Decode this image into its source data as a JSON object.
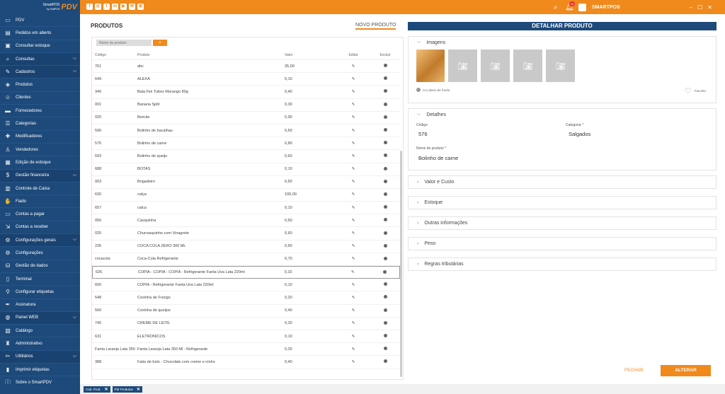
{
  "app": {
    "logo_small": "SmartPOS",
    "logo_small2": "by SoftPOS",
    "logo_big": "PDV",
    "brand": "SMARTPOS",
    "notif_count": "11"
  },
  "icons": {
    "search": "search-icon",
    "bell": "bell-icon",
    "minimize": "minimize-icon",
    "maximize": "maximize-icon",
    "close": "close-icon"
  },
  "colors": {
    "accent": "#f08a1c",
    "sidebar": "#1d4a7a"
  },
  "sidebar": {
    "items": [
      {
        "label": "PDV",
        "icon": "monitor-icon",
        "group": false
      },
      {
        "label": "Pedidos em aberto",
        "icon": "clipboard-icon",
        "group": false
      },
      {
        "label": "Consultar estoque",
        "icon": "box-icon",
        "group": false
      },
      {
        "label": "Consultas",
        "icon": "search-icon",
        "group": true
      },
      {
        "label": "Cadastros",
        "icon": "pencil-icon",
        "group": true
      },
      {
        "label": "Produtos",
        "icon": "tag-icon",
        "group": false
      },
      {
        "label": "Clientes",
        "icon": "user-icon",
        "group": false
      },
      {
        "label": "Fornecedores",
        "icon": "truck-icon",
        "group": false
      },
      {
        "label": "Categorias",
        "icon": "list-icon",
        "group": false
      },
      {
        "label": "Modificadores",
        "icon": "puzzle-icon",
        "group": false
      },
      {
        "label": "Vendedores",
        "icon": "person-icon",
        "group": false
      },
      {
        "label": "Edição de estoque",
        "icon": "edit-box-icon",
        "group": false
      },
      {
        "label": "Gestão financeira",
        "icon": "money-icon",
        "group": true
      },
      {
        "label": "Controle de Caixa",
        "icon": "register-icon",
        "group": false
      },
      {
        "label": "Fiado",
        "icon": "hand-icon",
        "group": false
      },
      {
        "label": "Contas a pagar",
        "icon": "card-icon",
        "group": false
      },
      {
        "label": "Contas a receber",
        "icon": "receive-icon",
        "group": false
      },
      {
        "label": "Configurações gerais",
        "icon": "gear-icon",
        "group": true
      },
      {
        "label": "Configurações",
        "icon": "gear-icon",
        "group": false
      },
      {
        "label": "Gestão de dados",
        "icon": "database-icon",
        "group": false
      },
      {
        "label": "Terminal",
        "icon": "terminal-icon",
        "group": false
      },
      {
        "label": "Configurar etiquetas",
        "icon": "label-icon",
        "group": false
      },
      {
        "label": "Assinatura",
        "icon": "pen-icon",
        "group": false
      },
      {
        "label": "Painel WEB",
        "icon": "globe-icon",
        "group": true
      },
      {
        "label": "Catálogo",
        "icon": "book-icon",
        "group": false
      },
      {
        "label": "Administrativo",
        "icon": "admin-icon",
        "group": false
      },
      {
        "label": "Utilitários",
        "icon": "tools-icon",
        "group": true
      },
      {
        "label": "Imprimir etiquetas",
        "icon": "barcode-icon",
        "group": false
      },
      {
        "label": "Sobre o SmartPDV",
        "icon": "info-icon",
        "group": false
      }
    ]
  },
  "products": {
    "title": "PRODUTOS",
    "new_button": "NOVO PRODUTO",
    "search_placeholder": "Nome do produto",
    "columns": {
      "code": "Código",
      "product": "Produto",
      "value": "Valor",
      "edit": "Editar",
      "delete": "Excluir"
    },
    "rows": [
      {
        "code": "761",
        "name": "abc",
        "value": "35,00"
      },
      {
        "code": "649",
        "name": "ALEXA",
        "value": "0,10"
      },
      {
        "code": "340",
        "name": "Bala Fini Tubes Morango 80g",
        "value": "0,40"
      },
      {
        "code": "001",
        "name": "Banana Split",
        "value": "0,30"
      },
      {
        "code": "020",
        "name": "Beirute",
        "value": "0,90"
      },
      {
        "code": "596",
        "name": "Bolinho de bacalhau",
        "value": "0,50"
      },
      {
        "code": "576",
        "name": "Bolinho de carne",
        "value": "0,80"
      },
      {
        "code": "593",
        "name": "Bolinho de queijo",
        "value": "0,60"
      },
      {
        "code": "688",
        "name": "BOTAS",
        "value": "0,10"
      },
      {
        "code": "003",
        "name": "Brigadeiro",
        "value": "0,50"
      },
      {
        "code": "630",
        "name": "calça",
        "value": "100,00"
      },
      {
        "code": "657",
        "name": "calca",
        "value": "0,10"
      },
      {
        "code": "050",
        "name": "Casquinha",
        "value": "0,50"
      },
      {
        "code": "025",
        "name": "Churrasquinho com Vinagrete",
        "value": "0,60"
      },
      {
        "code": "235",
        "name": "COCA COLA ZERO 300 ML",
        "value": "0,60"
      },
      {
        "code": "cocacola",
        "name": "Coca-Cola Refrigerante",
        "value": "0,70"
      },
      {
        "code": "626",
        "name": "COPIA - COPIA - COPIA - Refrigerante Fanta Uva Lata 220ml",
        "value": "0,10",
        "selected": true
      },
      {
        "code": "600",
        "name": "COPIA - Refrigerante Fanta Uva Lata 220ml",
        "value": "0,10"
      },
      {
        "code": "548",
        "name": "Coxinha de Frango",
        "value": "0,20"
      },
      {
        "code": "566",
        "name": "Coxinha de queijos",
        "value": "0,40"
      },
      {
        "code": "745",
        "name": "CREME DE LEITE",
        "value": "0,20"
      },
      {
        "code": "631",
        "name": "ELETRONICOS",
        "value": "0,10"
      },
      {
        "code": "Fanta Laranja Lata 350",
        "name": "Fanta Laranja Lata 350 Ml - Refrigerante",
        "value": "0,20"
      },
      {
        "code": "388",
        "name": "Fatia de bolo - Chocolate com creme e ninho",
        "value": "0,40"
      }
    ]
  },
  "detail": {
    "title": "DETALHAR PRODUTO",
    "images_label": "Imagens",
    "bg_color_label": "Cor plano de fundo",
    "favorite_label": "Favorito",
    "details_label": "Detalhes",
    "code_label": "Código",
    "code_value": "576",
    "category_label": "Categoria *",
    "category_value": "Salgados",
    "name_label": "Nome do produto *",
    "name_value": "Bolinho de carne",
    "sections": [
      "Valor e Custo",
      "Estoque",
      "Outras informações",
      "Peso",
      "Regras tributárias"
    ],
    "close_button": "FECHAR",
    "save_button": "ALTERAR"
  },
  "bottom_tabs": [
    {
      "label": "Cad. Prod."
    },
    {
      "label": "Pdr Produtos"
    }
  ]
}
